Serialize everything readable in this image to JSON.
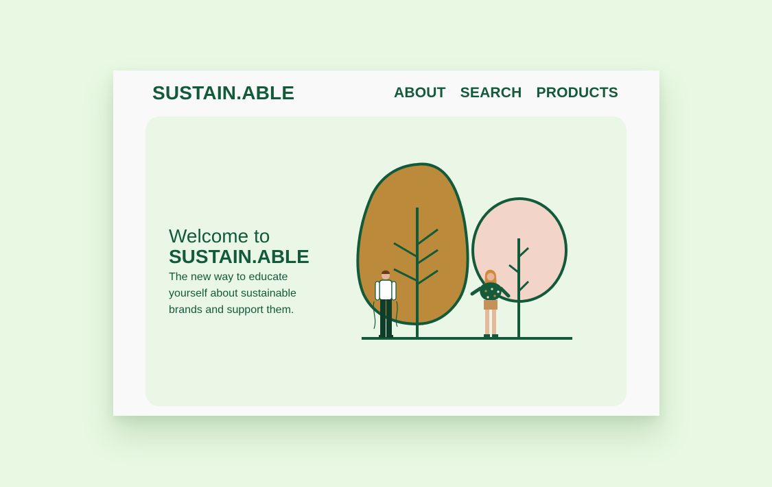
{
  "header": {
    "brand": "SUSTAIN.ABLE",
    "nav": [
      "ABOUT",
      "SEARCH",
      "PRODUCTS"
    ]
  },
  "hero": {
    "welcome": "Welcome to",
    "brand": "SUSTAIN.ABLE",
    "tagline": "The new way to educate yourself about sustainable brands and support them."
  },
  "colors": {
    "page_background": "#e8f8e2",
    "card_background": "#f8f9f8",
    "hero_background": "#ebf7e6",
    "brand_green": "#125a3a",
    "tree_ochre": "#bb8a3b",
    "tree_pink": "#f3d4c8"
  },
  "illustration": {
    "name": "trees-and-people-illustration"
  }
}
